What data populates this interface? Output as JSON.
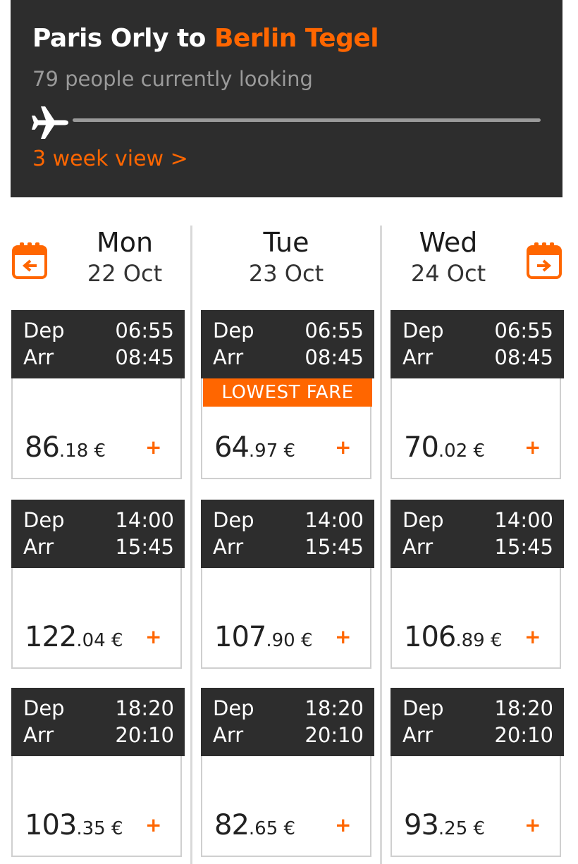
{
  "header": {
    "origin": "Paris Orly to ",
    "destination": "Berlin Tegel",
    "looking": "79 people currently looking",
    "week_view": "3 week view >"
  },
  "colors": {
    "accent": "#ff6600",
    "dark": "#2d2d2d",
    "muted": "#9a9a9a"
  },
  "labels": {
    "dep": "Dep",
    "arr": "Arr",
    "currency": " €",
    "lowest_fare": "LOWEST FARE",
    "add": "+"
  },
  "days": [
    {
      "name": "Mon",
      "date": "22 Oct",
      "flights": [
        {
          "dep": "06:55",
          "arr": "08:45",
          "price_int": "86",
          "price_dec": ".18"
        },
        {
          "dep": "14:00",
          "arr": "15:45",
          "price_int": "122",
          "price_dec": ".04"
        },
        {
          "dep": "18:20",
          "arr": "20:10",
          "price_int": "103",
          "price_dec": ".35"
        }
      ]
    },
    {
      "name": "Tue",
      "date": "23 Oct",
      "flights": [
        {
          "dep": "06:55",
          "arr": "08:45",
          "price_int": "64",
          "price_dec": ".97"
        },
        {
          "dep": "14:00",
          "arr": "15:45",
          "price_int": "107",
          "price_dec": ".90"
        },
        {
          "dep": "18:20",
          "arr": "20:10",
          "price_int": "82",
          "price_dec": ".65"
        }
      ]
    },
    {
      "name": "Wed",
      "date": "24 Oct",
      "flights": [
        {
          "dep": "06:55",
          "arr": "08:45",
          "price_int": "70",
          "price_dec": ".02"
        },
        {
          "dep": "14:00",
          "arr": "15:45",
          "price_int": "106",
          "price_dec": ".89"
        },
        {
          "dep": "18:20",
          "arr": "20:10",
          "price_int": "93",
          "price_dec": ".25"
        }
      ]
    }
  ],
  "icons": {
    "plane": "plane-icon",
    "prev": "calendar-prev-icon",
    "next": "calendar-next-icon",
    "add": "add-icon"
  }
}
